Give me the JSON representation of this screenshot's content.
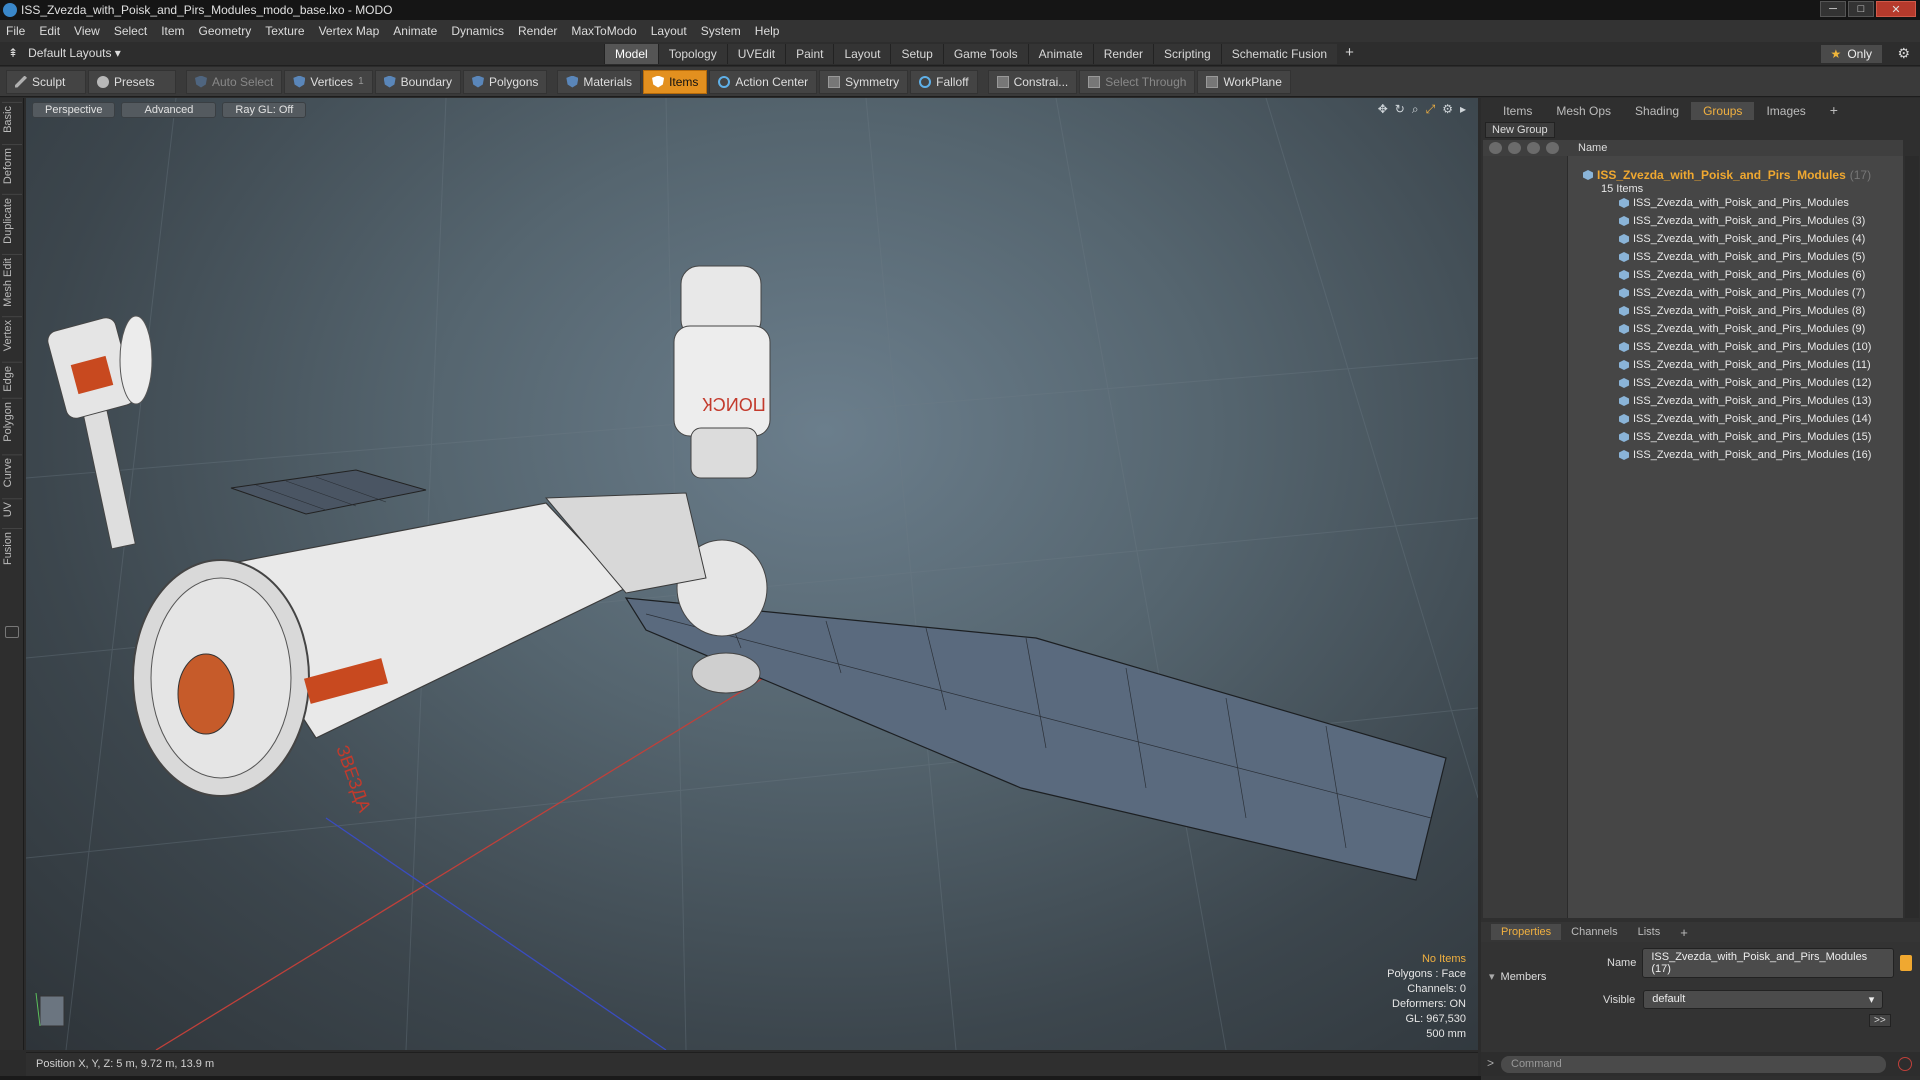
{
  "window": {
    "title": "ISS_Zvezda_with_Poisk_and_Pirs_Modules_modo_base.lxo - MODO",
    "controls": [
      "─",
      "□",
      "✕"
    ]
  },
  "menu": [
    "File",
    "Edit",
    "View",
    "Select",
    "Item",
    "Geometry",
    "Texture",
    "Vertex Map",
    "Animate",
    "Dynamics",
    "Render",
    "MaxToModo",
    "Layout",
    "System",
    "Help"
  ],
  "layout_selector": "Default Layouts ▾",
  "mode_tabs": [
    "Model",
    "Topology",
    "UVEdit",
    "Paint",
    "Layout",
    "Setup",
    "Game Tools",
    "Animate",
    "Render",
    "Scripting",
    "Schematic Fusion"
  ],
  "mode_tab_plus": "+",
  "only_button": "Only",
  "toolbar": {
    "sculpt": "Sculpt",
    "presets": "Presets",
    "auto_select": "Auto Select",
    "vertices": "Vertices",
    "vertices_count": "1",
    "boundary": "Boundary",
    "polygons": "Polygons",
    "materials": "Materials",
    "items": "Items",
    "action_center": "Action Center",
    "symmetry": "Symmetry",
    "falloff": "Falloff",
    "constraints": "Constrai...",
    "select_through": "Select Through",
    "workplane": "WorkPlane"
  },
  "left_tabs": [
    "Basic",
    "Deform",
    "Duplicate",
    "Mesh Edit",
    "Vertex",
    "Edge",
    "Polygon",
    "Curve",
    "UV",
    "Fusion"
  ],
  "viewport": {
    "view": "Perspective",
    "shading": "Advanced",
    "raygl": "Ray GL: Off",
    "model_labels": {
      "zvezda": "ЗВЕЗДА",
      "poisk": "ПОИСК"
    },
    "info": {
      "no_items": "No Items",
      "polygons": "Polygons : Face",
      "channels": "Channels: 0",
      "deformers": "Deformers: ON",
      "gl": "GL: 967,530",
      "scale": "500 mm"
    }
  },
  "status": {
    "position": "Position X, Y, Z:  5 m, 9.72 m, 13.9 m"
  },
  "right_panel": {
    "tabs": [
      "Items",
      "Mesh Ops",
      "Shading",
      "Groups",
      "Images"
    ],
    "active_tab": "Groups",
    "new_group": "New Group",
    "column_name": "Name",
    "group": {
      "name": "ISS_Zvezda_with_Poisk_and_Pirs_Modules",
      "count": "(17)",
      "subtitle": "15 Items"
    },
    "items": [
      "ISS_Zvezda_with_Poisk_and_Pirs_Modules",
      "ISS_Zvezda_with_Poisk_and_Pirs_Modules (3)",
      "ISS_Zvezda_with_Poisk_and_Pirs_Modules (4)",
      "ISS_Zvezda_with_Poisk_and_Pirs_Modules (5)",
      "ISS_Zvezda_with_Poisk_and_Pirs_Modules (6)",
      "ISS_Zvezda_with_Poisk_and_Pirs_Modules (7)",
      "ISS_Zvezda_with_Poisk_and_Pirs_Modules (8)",
      "ISS_Zvezda_with_Poisk_and_Pirs_Modules (9)",
      "ISS_Zvezda_with_Poisk_and_Pirs_Modules (10)",
      "ISS_Zvezda_with_Poisk_and_Pirs_Modules (11)",
      "ISS_Zvezda_with_Poisk_and_Pirs_Modules (12)",
      "ISS_Zvezda_with_Poisk_and_Pirs_Modules (13)",
      "ISS_Zvezda_with_Poisk_and_Pirs_Modules (14)",
      "ISS_Zvezda_with_Poisk_and_Pirs_Modules (15)",
      "ISS_Zvezda_with_Poisk_and_Pirs_Modules (16)"
    ],
    "prop_tabs": [
      "Properties",
      "Channels",
      "Lists"
    ],
    "props": {
      "name_label": "Name",
      "name_value": "ISS_Zvezda_with_Poisk_and_Pirs_Modules (17)",
      "members": "Members",
      "visible_label": "Visible",
      "visible_value": "default",
      "expand": ">>"
    },
    "command_placeholder": "Command"
  }
}
